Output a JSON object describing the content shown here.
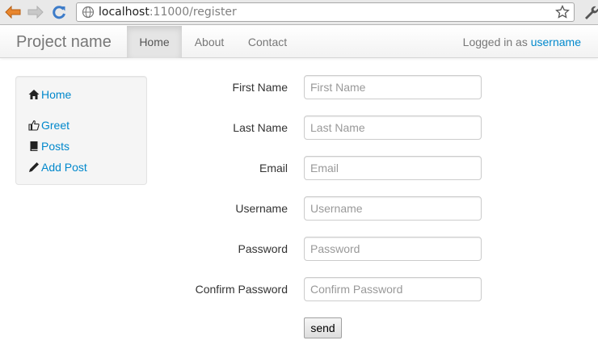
{
  "browser": {
    "url_host": "localhost",
    "url_rest": ":11000/register"
  },
  "navbar": {
    "brand": "Project name",
    "items": [
      {
        "label": "Home",
        "active": true
      },
      {
        "label": "About",
        "active": false
      },
      {
        "label": "Contact",
        "active": false
      }
    ],
    "login_prefix": "Logged in as ",
    "login_user": "username"
  },
  "sidebar": {
    "items": [
      {
        "label": "Home",
        "icon": "home-icon"
      },
      {
        "label": "Greet",
        "icon": "thumbs-up-icon"
      },
      {
        "label": "Posts",
        "icon": "book-icon"
      },
      {
        "label": "Add Post",
        "icon": "pencil-icon"
      }
    ]
  },
  "form": {
    "fields": [
      {
        "label": "First Name",
        "placeholder": "First Name",
        "value": ""
      },
      {
        "label": "Last Name",
        "placeholder": "Last Name",
        "value": ""
      },
      {
        "label": "Email",
        "placeholder": "Email",
        "value": ""
      },
      {
        "label": "Username",
        "placeholder": "Username",
        "value": ""
      },
      {
        "label": "Password",
        "placeholder": "Password",
        "value": ""
      },
      {
        "label": "Confirm Password",
        "placeholder": "Confirm Password",
        "value": ""
      }
    ],
    "submit_label": "send"
  },
  "colors": {
    "link": "#0088cc",
    "nav_text": "#777777",
    "active_nav_bg": "#e5e5e5"
  }
}
